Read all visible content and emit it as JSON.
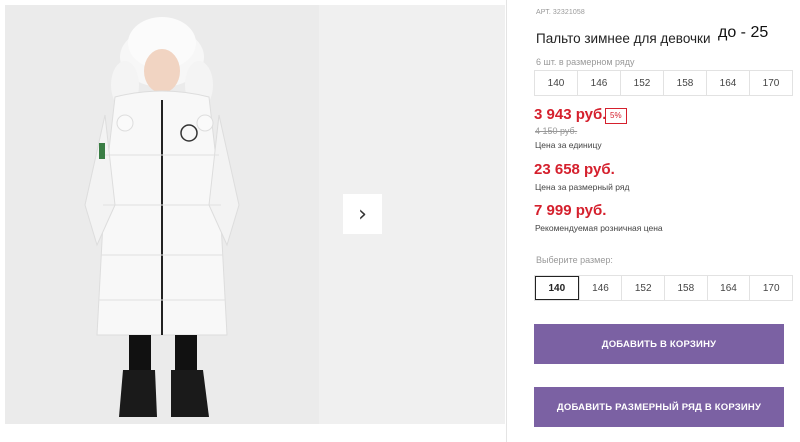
{
  "gallery": {
    "next_arrow": "›"
  },
  "product": {
    "article": "АРТ. 32321058",
    "title": "Пальто зимнее для девочки",
    "handwritten_note": "до - 25"
  },
  "size_row": {
    "caption": "6 шт. в размерном ряду",
    "sizes": [
      "140",
      "146",
      "152",
      "158",
      "164",
      "170"
    ]
  },
  "pricing": {
    "unit_price": "3 943 руб.",
    "discount": "5%",
    "old_price": "4 150 руб.",
    "unit_caption": "Цена за единицу",
    "row_price": "23 658 руб.",
    "row_caption": "Цена за размерный ряд",
    "retail_price": "7 999 руб.",
    "retail_caption": "Рекомендуемая розничная цена"
  },
  "size_picker": {
    "label": "Выберите размер:",
    "options": [
      "140",
      "146",
      "152",
      "158",
      "164",
      "170"
    ],
    "selected": "140"
  },
  "actions": {
    "add_to_cart": "ДОБАВИТЬ В КОРЗИНУ",
    "add_row_to_cart": "ДОБАВИТЬ РАЗМЕРНЫЙ РЯД В КОРЗИНУ"
  },
  "colors": {
    "price_red": "#d5202d",
    "button_purple": "#7b61a3"
  }
}
